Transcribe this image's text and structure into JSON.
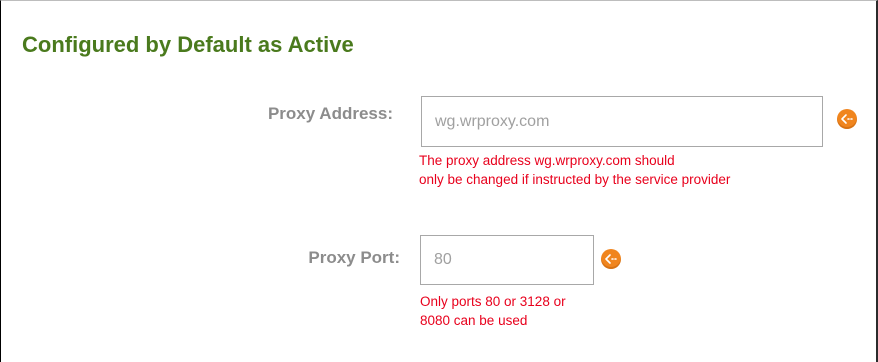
{
  "section": {
    "title": "Configured by Default as Active"
  },
  "proxy_address": {
    "label": "Proxy Address:",
    "value": "wg.wrproxy.com",
    "help_icon": "orange-circle-arrow-icon",
    "hint_lines": [
      "The proxy address wg.wrproxy.com should",
      "only be changed if instructed by the service provider"
    ]
  },
  "proxy_port": {
    "label": "Proxy Port:",
    "value": "80",
    "help_icon": "orange-circle-arrow-icon",
    "hint_lines": [
      "Only ports 80 or 3128 or",
      "8080 can be used"
    ]
  },
  "colors": {
    "title": "#4a7a1d",
    "label": "#8c8c8c",
    "hint": "#e8001c",
    "icon": "#f0851e",
    "input_text": "#a0a0a0",
    "input_border": "#a8a8a8"
  }
}
